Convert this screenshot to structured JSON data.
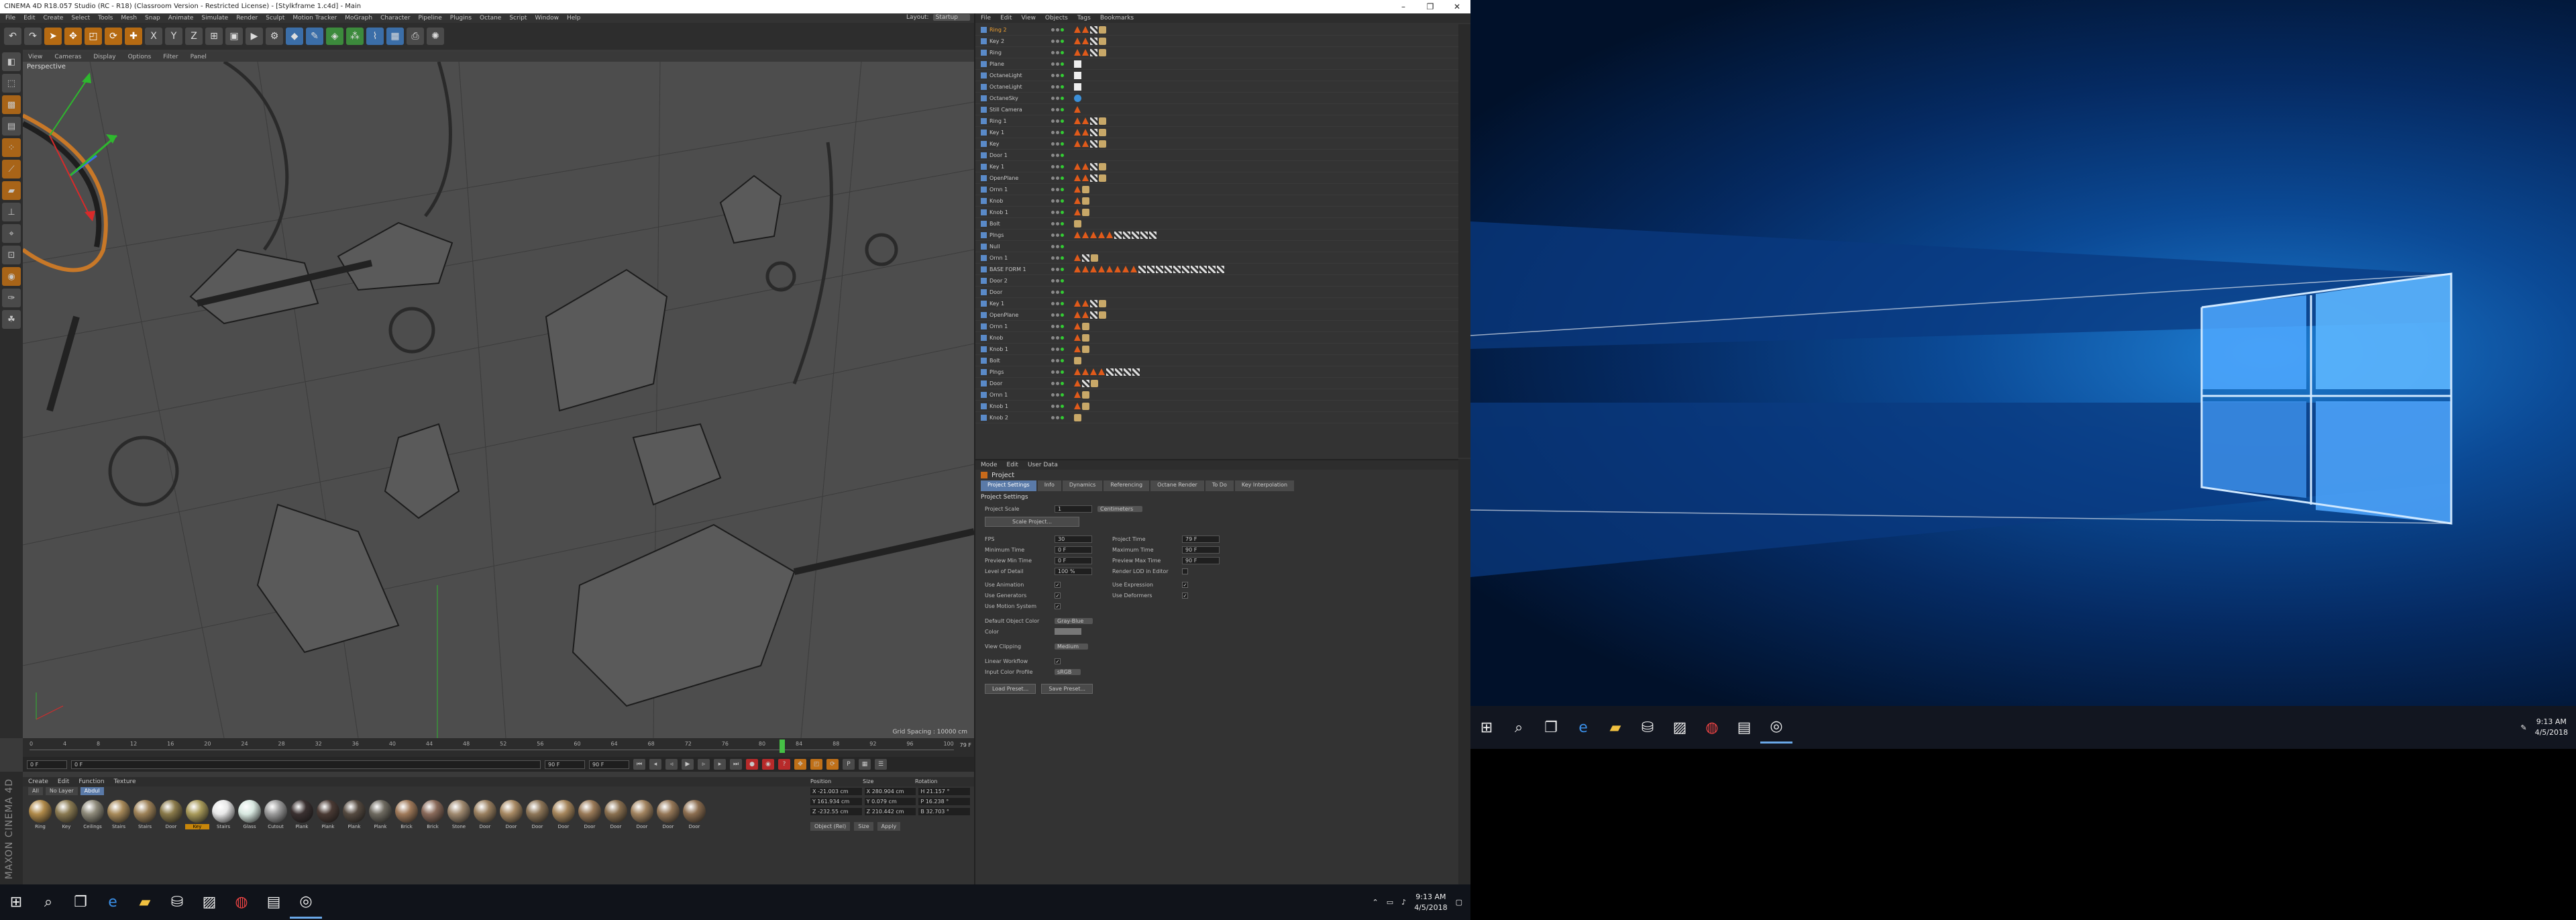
{
  "window": {
    "title": "CINEMA 4D R18.057 Studio (RC - R18) (Classroom Version - Restricted License) - [Stylkframe 1.c4d] - Main",
    "controls": [
      "–",
      "❐",
      "✕"
    ]
  },
  "menu": {
    "items": [
      "File",
      "Edit",
      "Create",
      "Select",
      "Tools",
      "Mesh",
      "Snap",
      "Animate",
      "Simulate",
      "Render",
      "Sculpt",
      "Motion Tracker",
      "MoGraph",
      "Character",
      "Pipeline",
      "Plugins",
      "Octane",
      "Script",
      "Window",
      "Help"
    ],
    "layout_label": "Layout:",
    "layout_value": "Startup"
  },
  "toolbar": {
    "icons": [
      "undo-icon",
      "redo-icon",
      "select-icon",
      "move-icon",
      "scale-icon",
      "rotate-icon",
      "add-icon",
      "x-axis-icon",
      "y-axis-icon",
      "z-axis-icon",
      "coord-icon",
      "render-view-icon",
      "render-icon",
      "render-settings-icon",
      "cube-icon",
      "pen-icon",
      "subdivision-icon",
      "cloner-icon",
      "deformer-icon",
      "scene-icon",
      "camera-icon",
      "light-icon"
    ],
    "axis_labels": [
      "X",
      "Y",
      "Z"
    ]
  },
  "viewport": {
    "menu": [
      "View",
      "Cameras",
      "Display",
      "Options",
      "Filter",
      "Panel"
    ],
    "label": "Perspective",
    "grid_spacing": "Grid Spacing : 10000 cm"
  },
  "timeline": {
    "ticks": [
      "0",
      "4",
      "8",
      "12",
      "16",
      "20",
      "24",
      "28",
      "32",
      "36",
      "40",
      "44",
      "48",
      "52",
      "56",
      "60",
      "64",
      "68",
      "72",
      "76",
      "80",
      "84",
      "88",
      "92",
      "96",
      "100"
    ],
    "current_frame": "79 F",
    "start_field": "0 F",
    "end_field": "90 F",
    "end_field2": "90 F",
    "frame_value": "0 F"
  },
  "material_manager": {
    "menu": [
      "Create",
      "Edit",
      "Function",
      "Texture"
    ],
    "filters": [
      "All",
      "No Layer",
      "Abdul"
    ],
    "selected_filter": "Abdul",
    "materials": [
      {
        "name": "Ring",
        "color": "#b08a4a"
      },
      {
        "name": "Key",
        "color": "#8a7a52"
      },
      {
        "name": "Ceilings",
        "color": "#8e8a7a"
      },
      {
        "name": "Stairs",
        "color": "#a88a5a"
      },
      {
        "name": "Stairs",
        "color": "#9e8258"
      },
      {
        "name": "Door",
        "color": "#8a7a4a"
      },
      {
        "name": "Key",
        "color": "#a89a5a"
      },
      {
        "name": "Stairs",
        "color": "#e8e8e8"
      },
      {
        "name": "Glass",
        "color": "#d8e8e0"
      },
      {
        "name": "Cutout",
        "color": "#9a9a9a"
      },
      {
        "name": "Plank",
        "color": "#3a3030"
      },
      {
        "name": "Plank",
        "color": "#4a3a34"
      },
      {
        "name": "Plank",
        "color": "#554a40"
      },
      {
        "name": "Plank",
        "color": "#6e6a60"
      },
      {
        "name": "Brick",
        "color": "#a07a5a"
      },
      {
        "name": "Brick",
        "color": "#8a6a5a"
      },
      {
        "name": "Stone",
        "color": "#a08a70"
      },
      {
        "name": "Door",
        "color": "#9a8060"
      },
      {
        "name": "Door",
        "color": "#a88a64"
      },
      {
        "name": "Door",
        "color": "#8e7658"
      },
      {
        "name": "Door",
        "color": "#a6865c"
      },
      {
        "name": "Door",
        "color": "#9a7a58"
      },
      {
        "name": "Door",
        "color": "#8a7050"
      },
      {
        "name": "Door",
        "color": "#a28460"
      },
      {
        "name": "Door",
        "color": "#967858"
      },
      {
        "name": "Door",
        "color": "#8c6e50"
      }
    ],
    "selected_index": 6
  },
  "coordinates": {
    "headers": [
      "Position",
      "Size",
      "Rotation"
    ],
    "rows": [
      [
        "X  -21.003 cm",
        "X  280.904 cm",
        "H  21.157 °"
      ],
      [
        "Y  161.934 cm",
        "Y  0.079 cm",
        "P  16.238 °"
      ],
      [
        "Z  -232.55 cm",
        "Z  210.442 cm",
        "B  32.703 °"
      ]
    ],
    "mode": "Object (Rel)",
    "size_mode": "Size",
    "apply": "Apply"
  },
  "objects": {
    "menu": [
      "File",
      "Edit",
      "View",
      "Objects",
      "Tags",
      "Bookmarks"
    ],
    "rows": [
      {
        "name": "Ring 2",
        "tags": "tri,tri,chk,mat",
        "sel": true
      },
      {
        "name": "Key 2",
        "tags": "tri,tri,chk,mat"
      },
      {
        "name": "Ring",
        "tags": "tri,tri,chk,mat"
      },
      {
        "name": "Plane",
        "tags": "wht"
      },
      {
        "name": "OctaneLight",
        "tags": "wht"
      },
      {
        "name": "OctaneLight",
        "tags": "wht"
      },
      {
        "name": "OctaneSky",
        "tags": "blu"
      },
      {
        "name": "Still Camera",
        "tags": "tri"
      },
      {
        "name": "Ring 1",
        "tags": "tri,tri,chk,mat"
      },
      {
        "name": "Key 1",
        "tags": "tri,tri,chk,mat"
      },
      {
        "name": "Key",
        "tags": "tri,tri,chk,mat"
      },
      {
        "name": "Door 1",
        "tags": ""
      },
      {
        "name": "Key 1",
        "tags": "tri,tri,chk,mat"
      },
      {
        "name": "OpenPlane",
        "tags": "tri,tri,chk,mat"
      },
      {
        "name": "Ornn 1",
        "tags": "tri,mat"
      },
      {
        "name": "Knob",
        "tags": "tri,mat"
      },
      {
        "name": "Knob 1",
        "tags": "tri,mat"
      },
      {
        "name": "Bolt",
        "tags": "mat"
      },
      {
        "name": "Plngs",
        "tags": "tri,tri,tri,tri,tri,chk,chk,chk,chk,chk"
      },
      {
        "name": "Null",
        "tags": ""
      },
      {
        "name": "Ornn 1",
        "tags": "tri,chk,mat"
      },
      {
        "name": "BASE FORM 1",
        "tags": "tri,tri,tri,tri,tri,tri,tri,tri,chk,chk,chk,chk,chk,chk,chk,chk,chk,chk"
      },
      {
        "name": "Door 2",
        "tags": ""
      },
      {
        "name": "Door",
        "tags": ""
      },
      {
        "name": "Key 1",
        "tags": "tri,tri,chk,mat"
      },
      {
        "name": "OpenPlane",
        "tags": "tri,tri,chk,mat"
      },
      {
        "name": "Ornn 1",
        "tags": "tri,mat"
      },
      {
        "name": "Knob",
        "tags": "tri,mat"
      },
      {
        "name": "Knob 1",
        "tags": "tri,mat"
      },
      {
        "name": "Bolt",
        "tags": "mat"
      },
      {
        "name": "Plngs",
        "tags": "tri,tri,tri,tri,chk,chk,chk,chk"
      },
      {
        "name": "Door",
        "tags": "tri,chk,mat"
      },
      {
        "name": "Ornn 1",
        "tags": "tri,mat"
      },
      {
        "name": "Knob 1",
        "tags": "tri,mat"
      },
      {
        "name": "Knob 2",
        "tags": "mat"
      }
    ]
  },
  "attributes": {
    "menu": [
      "Mode",
      "Edit",
      "User Data"
    ],
    "title": "Project",
    "tabs": [
      "Project Settings",
      "Info",
      "Dynamics",
      "Referencing",
      "Octane Render",
      "To Do",
      "Key Interpolation"
    ],
    "section": "Project Settings",
    "project_scale_label": "Project Scale",
    "project_scale_value": "1",
    "project_scale_unit": "Centimeters",
    "scale_button": "Scale Project...",
    "fields_left": [
      {
        "label": "FPS",
        "value": "30"
      },
      {
        "label": "Minimum Time",
        "value": "0 F"
      },
      {
        "label": "Preview Min Time",
        "value": "0 F"
      },
      {
        "label": "Level of Detail",
        "value": "100 %"
      }
    ],
    "fields_right": [
      {
        "label": "Project Time",
        "value": "79 F"
      },
      {
        "label": "Maximum Time",
        "value": "90 F"
      },
      {
        "label": "Preview Max Time",
        "value": "90 F"
      },
      {
        "label": "Render LOD in Editor",
        "value": ""
      }
    ],
    "checks_left": [
      {
        "label": "Use Animation",
        "value": "✓"
      },
      {
        "label": "Use Generators",
        "value": "✓"
      },
      {
        "label": "Use Motion System",
        "value": "✓"
      }
    ],
    "checks_right": [
      {
        "label": "Use Expression",
        "value": "✓"
      },
      {
        "label": "Use Deformers",
        "value": "✓"
      }
    ],
    "default_color_label": "Default Object Color",
    "default_color_value": "Gray-Blue",
    "color_label": "Color",
    "view_clipping_label": "View Clipping",
    "view_clipping_value": "Medium",
    "linear_workflow_label": "Linear Workflow",
    "linear_workflow_value": "✓",
    "input_color_label": "Input Color Profile",
    "input_color_value": "sRGB",
    "load_preset": "Load Preset...",
    "save_preset": "Save Preset..."
  },
  "taskbar_left": {
    "icons": [
      "windows-icon",
      "search-icon",
      "task-view-icon",
      "edge-icon",
      "file-explorer-icon",
      "store-icon",
      "photos-icon",
      "chrome-icon",
      "files-icon",
      "cinema4d-icon"
    ],
    "time": "9:13 AM",
    "date": "4/5/2018"
  },
  "taskbar_right": {
    "icons": [
      "windows-icon",
      "search-icon",
      "task-view-icon",
      "edge-icon",
      "file-explorer-icon",
      "store-icon",
      "photos-icon",
      "chrome-icon",
      "files-icon",
      "cinema4d-icon"
    ],
    "time": "9:13 AM",
    "date": "4/5/2018"
  },
  "maxon_logo": "MAXON CINEMA 4D"
}
